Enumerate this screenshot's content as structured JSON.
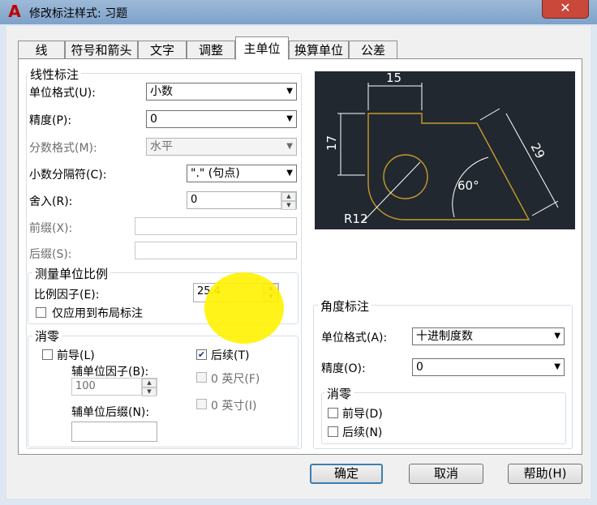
{
  "window": {
    "title": "修改标注样式: 习题",
    "logo": "A",
    "close": "✕"
  },
  "tabs": [
    "线",
    "符号和箭头",
    "文字",
    "调整",
    "主单位",
    "换算单位",
    "公差"
  ],
  "linear": {
    "group_title": "线性标注",
    "unit_format_label": "单位格式(U):",
    "unit_format_value": "小数",
    "precision_label": "精度(P):",
    "precision_value": "0",
    "fraction_label": "分数格式(M):",
    "fraction_value": "水平",
    "decimal_sep_label": "小数分隔符(C):",
    "decimal_sep_value": "\".\" (句点)",
    "round_label": "舍入(R):",
    "round_value": "0",
    "prefix_label": "前缀(X):",
    "prefix_value": "",
    "suffix_label": "后缀(S):",
    "suffix_value": ""
  },
  "scale": {
    "group_title": "测量单位比例",
    "factor_label": "比例因子(E):",
    "factor_value": "25.4",
    "layout_only_label": "仅应用到布局标注",
    "layout_only_checked": false
  },
  "zero_linear": {
    "group_title": "消零",
    "leading_label": "前导(L)",
    "leading_checked": false,
    "trailing_label": "后续(T)",
    "trailing_checked": true,
    "sub_factor_label": "辅单位因子(B):",
    "sub_factor_value": "100",
    "feet_label": "0 英尺(F)",
    "inches_label": "0 英寸(I)",
    "sub_suffix_label": "辅单位后缀(N):",
    "sub_suffix_value": ""
  },
  "angular": {
    "group_title": "角度标注",
    "unit_format_label": "单位格式(A):",
    "unit_format_value": "十进制度数",
    "precision_label": "精度(O):",
    "precision_value": "0",
    "zero_title": "消零",
    "leading_label": "前导(D)",
    "trailing_label": "后续(N)"
  },
  "preview": {
    "dim_top": "15",
    "dim_left": "17",
    "dim_slant": "29",
    "angle": "60°",
    "radius": "R12"
  },
  "buttons": {
    "ok": "确定",
    "cancel": "取消",
    "help": "帮助(H)"
  }
}
